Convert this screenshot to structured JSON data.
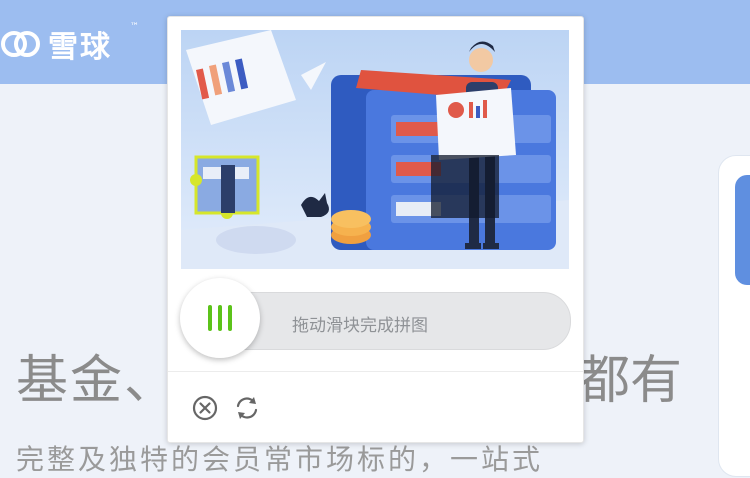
{
  "background": {
    "brand_name": "雪球",
    "brand_tm": "™",
    "hero_title": "基金、",
    "hero_title_tail": "都有",
    "hero_subtitle": "完整及独特的会员常市场标的，一站式"
  },
  "captcha": {
    "slider_hint": "拖动滑块完成拼图",
    "icons": {
      "close": "close-circle-icon",
      "refresh": "refresh-icon"
    },
    "colors": {
      "handle_accent": "#5cc31a",
      "track": "#e6e7e9",
      "puzzle_outline": "#d6e62b"
    }
  }
}
